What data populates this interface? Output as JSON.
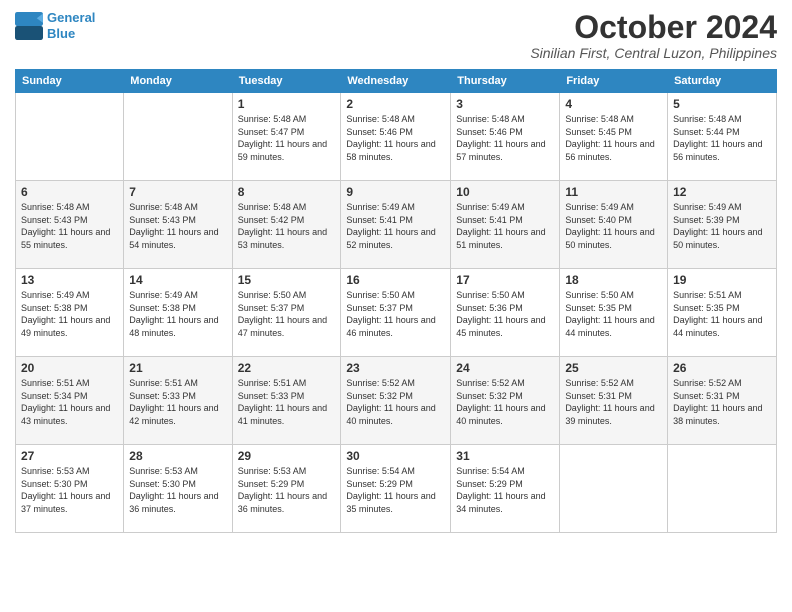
{
  "logo": {
    "line1": "General",
    "line2": "Blue"
  },
  "title": "October 2024",
  "subtitle": "Sinilian First, Central Luzon, Philippines",
  "days_header": [
    "Sunday",
    "Monday",
    "Tuesday",
    "Wednesday",
    "Thursday",
    "Friday",
    "Saturday"
  ],
  "weeks": [
    [
      {
        "day": "",
        "info": ""
      },
      {
        "day": "",
        "info": ""
      },
      {
        "day": "1",
        "info": "Sunrise: 5:48 AM\nSunset: 5:47 PM\nDaylight: 11 hours and 59 minutes."
      },
      {
        "day": "2",
        "info": "Sunrise: 5:48 AM\nSunset: 5:46 PM\nDaylight: 11 hours and 58 minutes."
      },
      {
        "day": "3",
        "info": "Sunrise: 5:48 AM\nSunset: 5:46 PM\nDaylight: 11 hours and 57 minutes."
      },
      {
        "day": "4",
        "info": "Sunrise: 5:48 AM\nSunset: 5:45 PM\nDaylight: 11 hours and 56 minutes."
      },
      {
        "day": "5",
        "info": "Sunrise: 5:48 AM\nSunset: 5:44 PM\nDaylight: 11 hours and 56 minutes."
      }
    ],
    [
      {
        "day": "6",
        "info": "Sunrise: 5:48 AM\nSunset: 5:43 PM\nDaylight: 11 hours and 55 minutes."
      },
      {
        "day": "7",
        "info": "Sunrise: 5:48 AM\nSunset: 5:43 PM\nDaylight: 11 hours and 54 minutes."
      },
      {
        "day": "8",
        "info": "Sunrise: 5:48 AM\nSunset: 5:42 PM\nDaylight: 11 hours and 53 minutes."
      },
      {
        "day": "9",
        "info": "Sunrise: 5:49 AM\nSunset: 5:41 PM\nDaylight: 11 hours and 52 minutes."
      },
      {
        "day": "10",
        "info": "Sunrise: 5:49 AM\nSunset: 5:41 PM\nDaylight: 11 hours and 51 minutes."
      },
      {
        "day": "11",
        "info": "Sunrise: 5:49 AM\nSunset: 5:40 PM\nDaylight: 11 hours and 50 minutes."
      },
      {
        "day": "12",
        "info": "Sunrise: 5:49 AM\nSunset: 5:39 PM\nDaylight: 11 hours and 50 minutes."
      }
    ],
    [
      {
        "day": "13",
        "info": "Sunrise: 5:49 AM\nSunset: 5:38 PM\nDaylight: 11 hours and 49 minutes."
      },
      {
        "day": "14",
        "info": "Sunrise: 5:49 AM\nSunset: 5:38 PM\nDaylight: 11 hours and 48 minutes."
      },
      {
        "day": "15",
        "info": "Sunrise: 5:50 AM\nSunset: 5:37 PM\nDaylight: 11 hours and 47 minutes."
      },
      {
        "day": "16",
        "info": "Sunrise: 5:50 AM\nSunset: 5:37 PM\nDaylight: 11 hours and 46 minutes."
      },
      {
        "day": "17",
        "info": "Sunrise: 5:50 AM\nSunset: 5:36 PM\nDaylight: 11 hours and 45 minutes."
      },
      {
        "day": "18",
        "info": "Sunrise: 5:50 AM\nSunset: 5:35 PM\nDaylight: 11 hours and 44 minutes."
      },
      {
        "day": "19",
        "info": "Sunrise: 5:51 AM\nSunset: 5:35 PM\nDaylight: 11 hours and 44 minutes."
      }
    ],
    [
      {
        "day": "20",
        "info": "Sunrise: 5:51 AM\nSunset: 5:34 PM\nDaylight: 11 hours and 43 minutes."
      },
      {
        "day": "21",
        "info": "Sunrise: 5:51 AM\nSunset: 5:33 PM\nDaylight: 11 hours and 42 minutes."
      },
      {
        "day": "22",
        "info": "Sunrise: 5:51 AM\nSunset: 5:33 PM\nDaylight: 11 hours and 41 minutes."
      },
      {
        "day": "23",
        "info": "Sunrise: 5:52 AM\nSunset: 5:32 PM\nDaylight: 11 hours and 40 minutes."
      },
      {
        "day": "24",
        "info": "Sunrise: 5:52 AM\nSunset: 5:32 PM\nDaylight: 11 hours and 40 minutes."
      },
      {
        "day": "25",
        "info": "Sunrise: 5:52 AM\nSunset: 5:31 PM\nDaylight: 11 hours and 39 minutes."
      },
      {
        "day": "26",
        "info": "Sunrise: 5:52 AM\nSunset: 5:31 PM\nDaylight: 11 hours and 38 minutes."
      }
    ],
    [
      {
        "day": "27",
        "info": "Sunrise: 5:53 AM\nSunset: 5:30 PM\nDaylight: 11 hours and 37 minutes."
      },
      {
        "day": "28",
        "info": "Sunrise: 5:53 AM\nSunset: 5:30 PM\nDaylight: 11 hours and 36 minutes."
      },
      {
        "day": "29",
        "info": "Sunrise: 5:53 AM\nSunset: 5:29 PM\nDaylight: 11 hours and 36 minutes."
      },
      {
        "day": "30",
        "info": "Sunrise: 5:54 AM\nSunset: 5:29 PM\nDaylight: 11 hours and 35 minutes."
      },
      {
        "day": "31",
        "info": "Sunrise: 5:54 AM\nSunset: 5:29 PM\nDaylight: 11 hours and 34 minutes."
      },
      {
        "day": "",
        "info": ""
      },
      {
        "day": "",
        "info": ""
      }
    ]
  ]
}
